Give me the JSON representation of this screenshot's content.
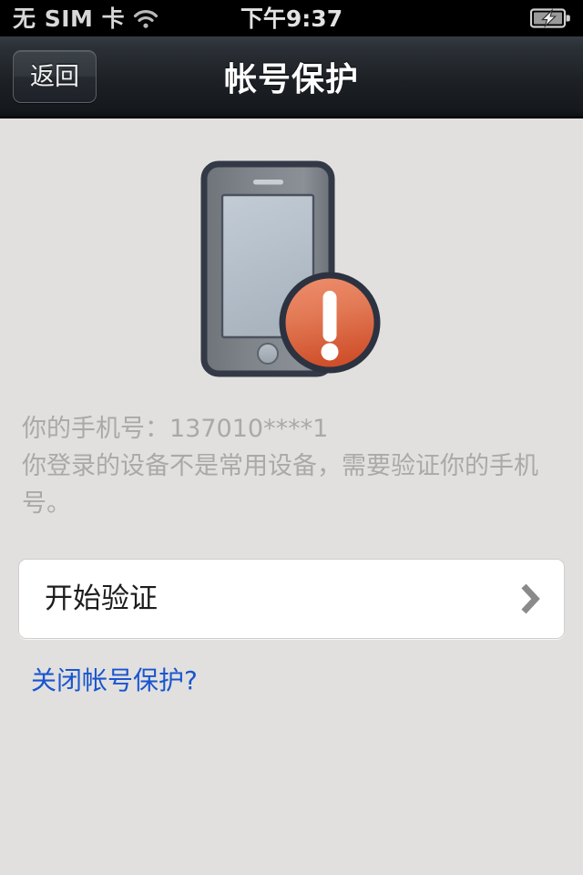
{
  "status_bar": {
    "carrier": "无 SIM 卡",
    "wifi_icon": "wifi-icon",
    "time": "下午9:37",
    "battery_icon": "battery-charging-icon"
  },
  "nav_bar": {
    "back_label": "返回",
    "title": "帐号保护"
  },
  "illustration": {
    "name": "phone-with-warning-badge-icon",
    "phone_outline_color": "#343a45",
    "phone_body_color": "#7e838a",
    "screen_color": "#b7c1cb",
    "badge_color_top": "#e9825f",
    "badge_color_bottom": "#d4542d",
    "badge_icon": "exclamation-mark"
  },
  "info": {
    "phone_label": "你的手机号：",
    "phone_number": "137010****1",
    "phone_line": "你的手机号：137010****1",
    "description": "你登录的设备不是常用设备，需要验证你的手机号。"
  },
  "action_card": {
    "label": "开始验证",
    "chevron_icon": "chevron-right-icon"
  },
  "footer_link": {
    "label": "关闭帐号保护?",
    "color": "#1a55cf"
  },
  "theme": {
    "background": "#e1e0de",
    "navbar_top": "#353b42",
    "navbar_bottom": "#0e1013",
    "card_background": "#ffffff",
    "muted_text": "#a9a9a7"
  }
}
